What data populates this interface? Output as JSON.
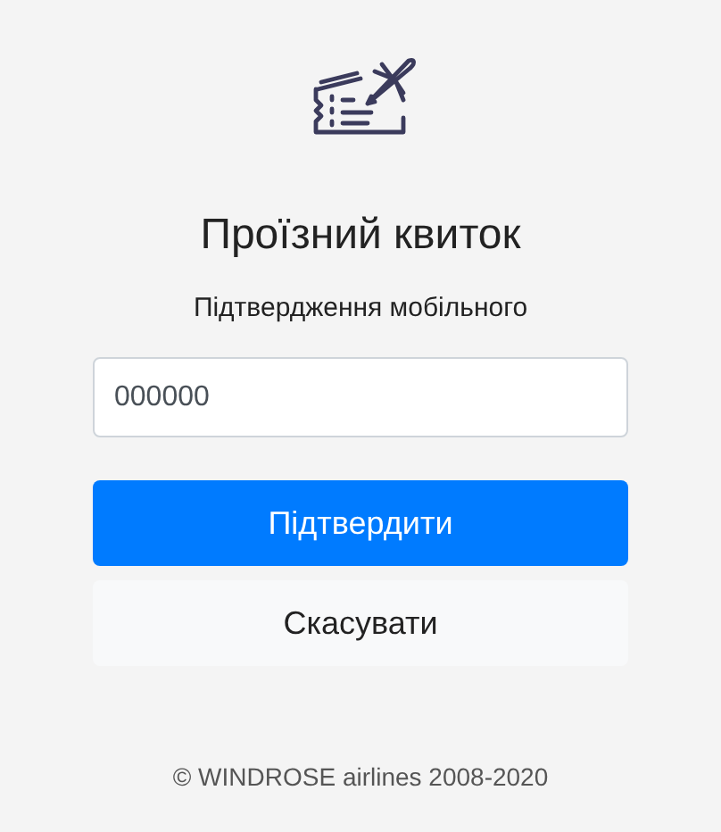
{
  "title": "Проїзний квиток",
  "subtitle": "Підтвердження мобільного",
  "code_field": {
    "value": "000000"
  },
  "buttons": [
    {
      "label": "Підтвердити",
      "kind": "primary"
    },
    {
      "label": "Скасувати",
      "kind": "secondary"
    }
  ],
  "footer": "© WINDROSE airlines 2008-2020"
}
